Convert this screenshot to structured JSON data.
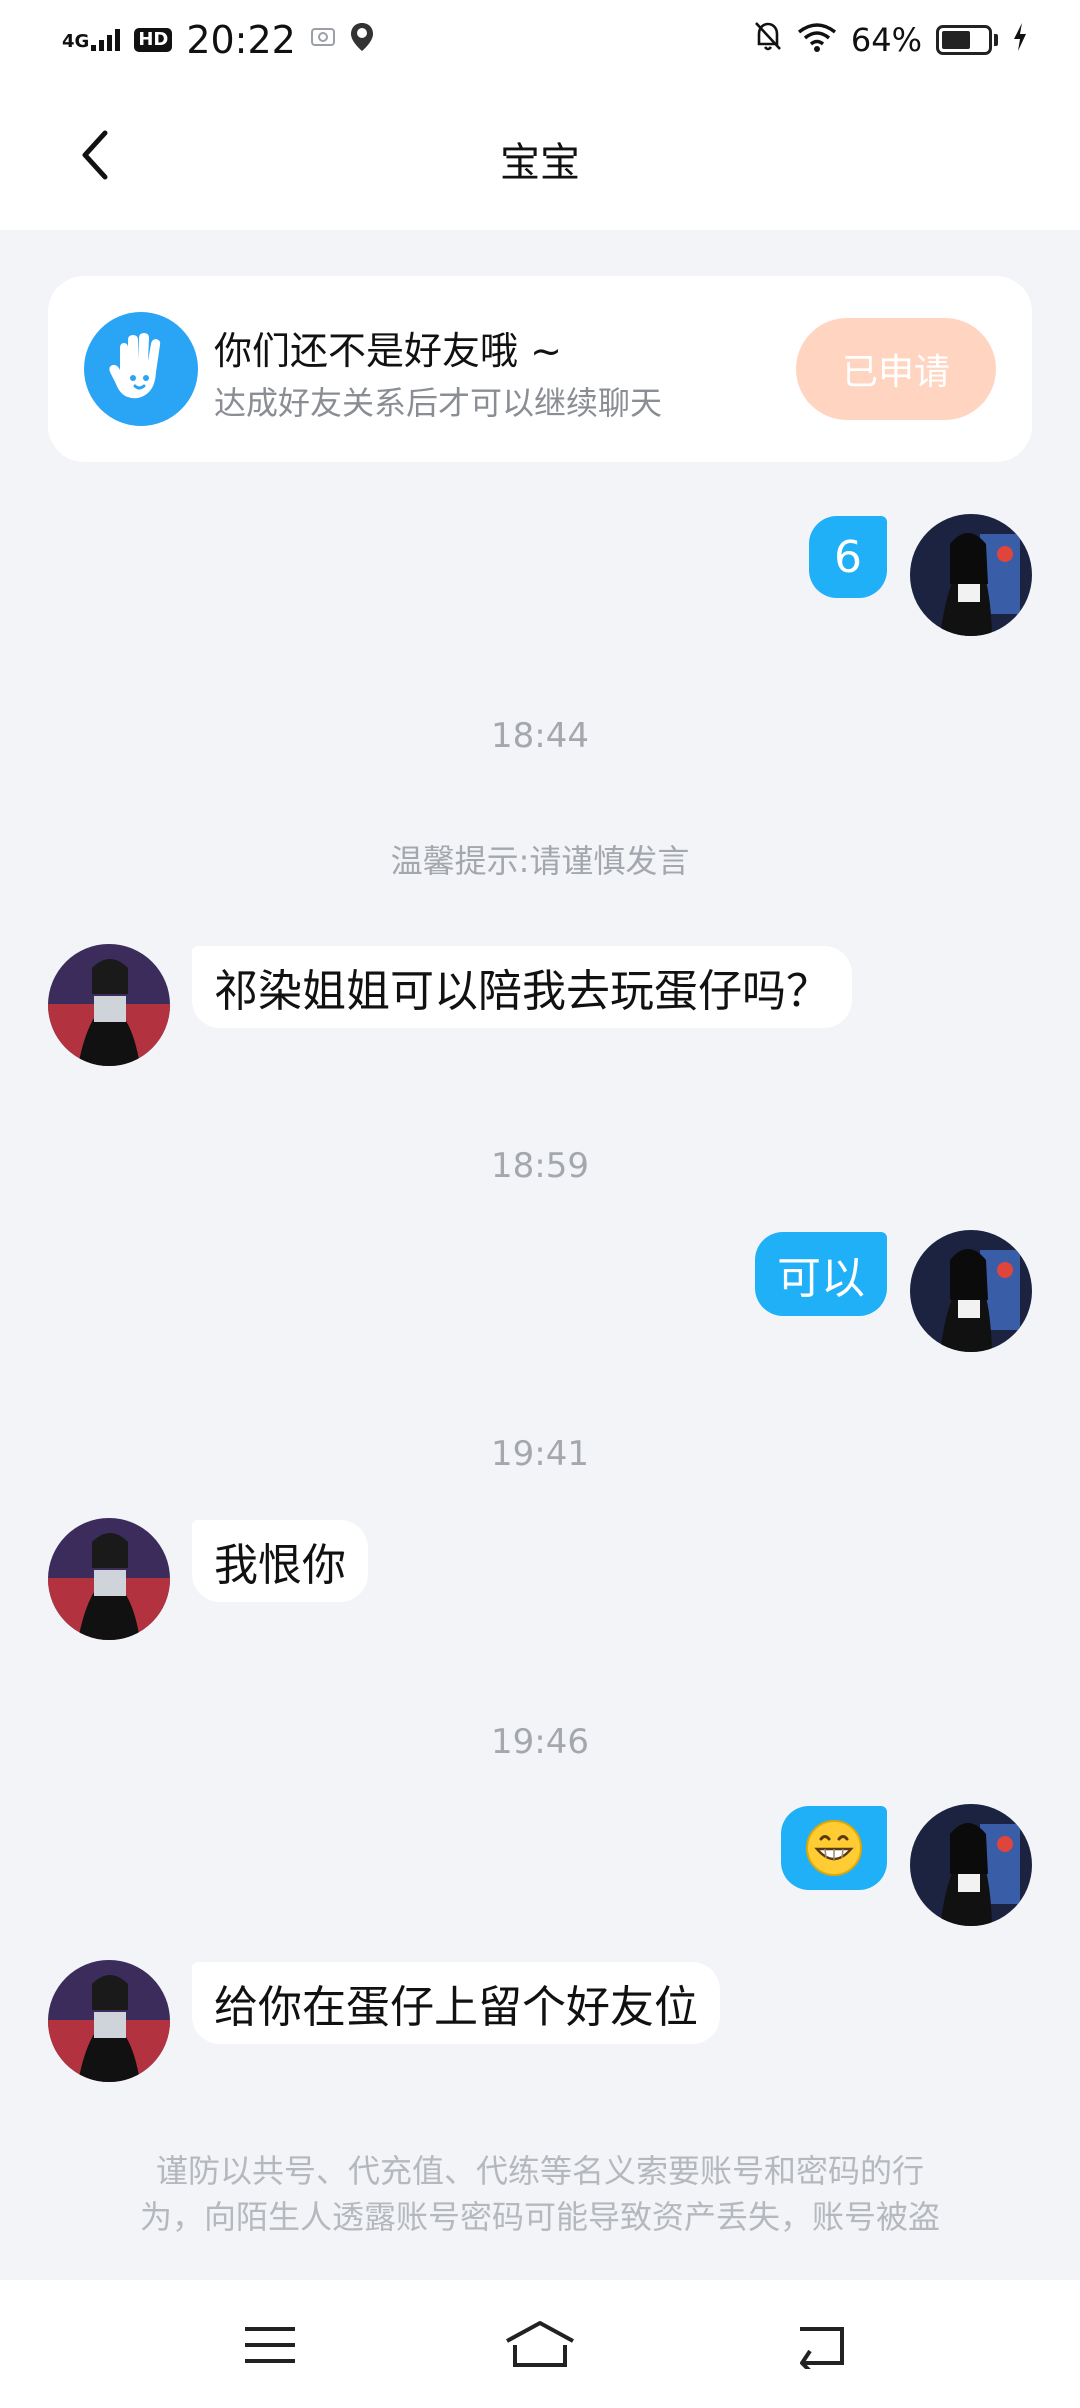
{
  "status_bar": {
    "network": "4G",
    "hd": "HD",
    "time": "20:22",
    "wifi_icon": "wifi-icon",
    "battery_percent_text": "64%",
    "battery_level": 0.64
  },
  "header": {
    "title": "宝宝",
    "back_icon": "chevron-left-icon"
  },
  "friend_notice": {
    "title": "你们还不是好友哦 ~",
    "subtitle": "达成好友关系后才可以继续聊天",
    "button_label": "已申请",
    "icon": "hand-icon"
  },
  "messages": [
    {
      "from": "me",
      "text": "6"
    },
    {
      "type": "time",
      "text": "18:44"
    },
    {
      "type": "tip",
      "text": "温馨提示:请谨慎发言"
    },
    {
      "from": "them",
      "text": "祁染姐姐可以陪我去玩蛋仔吗？"
    },
    {
      "type": "time",
      "text": "18:59"
    },
    {
      "from": "me",
      "text": "可以"
    },
    {
      "type": "time",
      "text": "19:41"
    },
    {
      "from": "them",
      "text": "我恨你"
    },
    {
      "type": "time",
      "text": "19:46"
    },
    {
      "from": "me",
      "text": "😁",
      "emoji": "grinning-face"
    },
    {
      "from": "them",
      "text": "给你在蛋仔上留个好友位"
    }
  ],
  "warning": {
    "line1": "谨防以共号、代充值、代练等名义索要账号和密码的行",
    "line2": "为，向陌生人透露账号密码可能导致资产丢失，账号被盗"
  },
  "system_nav": {
    "menu_icon": "menu-icon",
    "home_icon": "home-icon",
    "back_icon": "back-icon"
  }
}
